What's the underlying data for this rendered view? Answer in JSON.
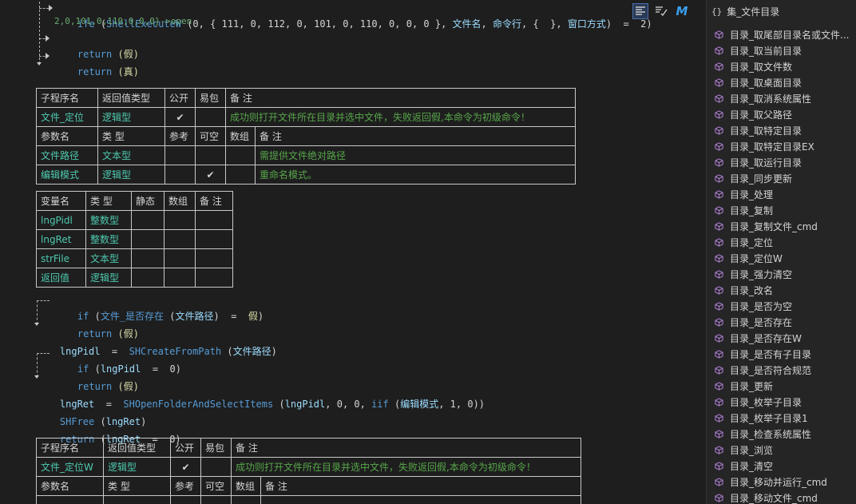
{
  "code": {
    "line1": {
      "kw": "ife",
      "p1": " (",
      "fn": "ShellExecuteW",
      "p2": " (0, { 111, 0, 112, 0, 101, 0, 110, 0, 0, 0 }, ",
      "a1": "文件名",
      "p3": ", ",
      "a2": "命令行",
      "p4": ", {  }, ",
      "a3": "窗口方式",
      "p5": ")  =  2)"
    },
    "line2": "2,0,101,0,110,0,0,0}->open",
    "ret_false": "return",
    "ret_false_arg": " (假)",
    "ret_true": "return",
    "ret_true_arg": " (真)",
    "if1": {
      "kw": "if",
      "p1": " (",
      "fn": "文件_是否存在",
      "p2": " (",
      "a": "文件路径",
      "p3": ")  =  ",
      "v": "假",
      "p4": ")"
    },
    "ret2": {
      "kw": "return",
      "p": " (假)"
    },
    "assign1": {
      "lhs": "lngPidl",
      "eq": "  =  ",
      "fn": "SHCreateFromPath",
      "p1": " (",
      "a": "文件路径",
      "p2": ")"
    },
    "if2": {
      "kw": "if",
      "p1": " (",
      "v": "lngPidl",
      "p2": "  =  0)"
    },
    "ret3": {
      "kw": "return",
      "p": " (假)"
    },
    "assign2": {
      "lhs": "lngRet",
      "eq": "  =  ",
      "fn": "SHOpenFolderAndSelectItems",
      "p1": " (",
      "v": "lngPidl",
      "p2": ", 0, 0, ",
      "f2": "iif",
      "p3": " (",
      "a": "编辑模式",
      "p4": ", 1, 0))"
    },
    "free": {
      "fn": "SHFree",
      "p1": " (",
      "v": "lngRet",
      "p2": ")"
    },
    "ret4": {
      "kw": "return",
      "p1": " (",
      "v": "lngRet",
      "p2": "  =  0)"
    }
  },
  "table1": {
    "head": [
      "子程序名",
      "返回值类型",
      "公开",
      "易包",
      "备 注"
    ],
    "row": {
      "name": "文件_定位",
      "type": "逻辑型",
      "public": "✔",
      "pkg": "",
      "note": "成功则打开文件所在目录并选中文件，失败返回假,本命令为初级命令！"
    },
    "param_head": [
      "参数名",
      "类 型",
      "参考",
      "可空",
      "数组",
      "备 注"
    ],
    "params": [
      {
        "name": "文件路径",
        "type": "文本型",
        "ref": "",
        "opt": "",
        "arr": "",
        "note": "需提供文件绝对路径"
      },
      {
        "name": "编辑模式",
        "type": "逻辑型",
        "ref": "",
        "opt": "✔",
        "arr": "",
        "note": "重命名模式。"
      }
    ]
  },
  "table2": {
    "head": [
      "变量名",
      "类 型",
      "静态",
      "数组",
      "备 注"
    ],
    "rows": [
      {
        "name": "lngPidl",
        "type": "整数型"
      },
      {
        "name": "lngRet",
        "type": "整数型"
      },
      {
        "name": "strFile",
        "type": "文本型"
      },
      {
        "name": "返回值",
        "type": "逻辑型"
      }
    ]
  },
  "table3": {
    "head": [
      "子程序名",
      "返回值类型",
      "公开",
      "易包",
      "备 注"
    ],
    "row": {
      "name": "文件_定位W",
      "type": "逻辑型",
      "public": "✔",
      "pkg": "",
      "note": "成功则打开文件所在目录并选中文件，失败返回假,本命令为初级命令！"
    },
    "param_head": [
      "参数名",
      "类 型",
      "参考",
      "可空",
      "数组",
      "备 注"
    ]
  },
  "toolbar": {
    "icons": [
      "format-icon",
      "spell-check-icon",
      "m-logo-icon"
    ],
    "m_label": "M"
  },
  "panel": {
    "title": "集_文件目录",
    "braces": "{}",
    "items": [
      "目录_取尾部目录名或文件...",
      "目录_取当前目录",
      "目录_取文件数",
      "目录_取桌面目录",
      "目录_取消系统属性",
      "目录_取父路径",
      "目录_取特定目录",
      "目录_取特定目录EX",
      "目录_取运行目录",
      "目录_同步更新",
      "目录_处理",
      "目录_复制",
      "目录_复制文件_cmd",
      "目录_定位",
      "目录_定位W",
      "目录_强力清空",
      "目录_改名",
      "目录_是否为空",
      "目录_是否存在",
      "目录_是否存在W",
      "目录_是否有子目录",
      "目录_是否符合规范",
      "目录_更新",
      "目录_枚举子目录",
      "目录_枚举子目录1",
      "目录_检查系统属性",
      "目录_浏览",
      "目录_清空",
      "目录_移动并运行_cmd",
      "目录_移动文件_cmd"
    ]
  },
  "colors": {
    "background": "#1e1e1e",
    "panel": "#252526",
    "keyword": "#569cd6",
    "type": "#4ec9b0",
    "comment": "#57a64a",
    "cube": "#b180d7"
  }
}
